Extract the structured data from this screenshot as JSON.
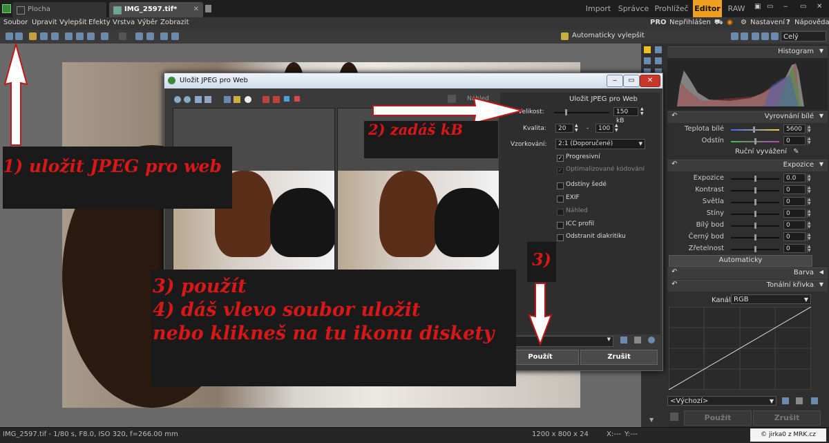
{
  "tabs": [
    {
      "label": "Plocha"
    },
    {
      "label": "IMG_2597.tif*"
    }
  ],
  "modes": {
    "import": "Import",
    "manager": "Správce",
    "viewer": "Prohlížeč",
    "editor": "Editor",
    "raw": "RAW"
  },
  "menu": [
    "Soubor",
    "Upravit",
    "Vylepšit",
    "Efekty",
    "Vrstva",
    "Výběr",
    "Zobrazit"
  ],
  "menu_right": {
    "pro": "PRO",
    "login": "Nepřihlášen",
    "settings": "Nastavení",
    "help": "Nápověda"
  },
  "toolbar_right": {
    "auto_enhance": "Automaticky vylepšit",
    "zoom": "Celý"
  },
  "panel": {
    "histogram": "Histogram",
    "white_balance": "Vyrovnání bílé",
    "wb_rows": [
      {
        "label": "Teplota bílé",
        "value": "5600"
      },
      {
        "label": "Odstín",
        "value": "0"
      }
    ],
    "manual_wb": "Ruční vyvážení",
    "exposure_title": "Expozice",
    "exposure_rows": [
      {
        "label": "Expozice",
        "value": "0.0"
      },
      {
        "label": "Kontrast",
        "value": "0"
      },
      {
        "label": "Světla",
        "value": "0"
      },
      {
        "label": "Stíny",
        "value": "0"
      },
      {
        "label": "Bílý bod",
        "value": "0"
      },
      {
        "label": "Černý bod",
        "value": "0"
      },
      {
        "label": "Zřetelnost",
        "value": "0"
      }
    ],
    "auto": "Automaticky",
    "color": "Barva",
    "tone_curve": "Tonální křivka",
    "channel_label": "Kanál:",
    "channel_value": "RGB",
    "preset": "<Výchozí>",
    "apply": "Použít",
    "cancel": "Zrušit"
  },
  "status": {
    "info": "IMG_2597.tif - 1/80 s, F8.0, ISO 320, f=266.00 mm",
    "size": "1200 x 800 x 24",
    "x": "X:---",
    "y": "Y:---",
    "credit": "© jirka0 z MRK.cz"
  },
  "dialog": {
    "title": "Uložit JPEG pro Web",
    "preview_tab": "Náhled",
    "right_title": "Uložit JPEG pro Web",
    "size_label": "Velikost:",
    "size_value": "150 kB",
    "quality_label": "Kvalita:",
    "quality_from": "20",
    "quality_dash": "-",
    "quality_to": "100",
    "sampling_label": "Vzorkování:",
    "sampling_value": "2:1 (Doporučené)",
    "options": [
      {
        "label": "Progresivní",
        "checked": true,
        "disabled": false
      },
      {
        "label": "Optimalizované kódování",
        "checked": true,
        "disabled": true
      },
      {
        "label": "Odstíny šedé",
        "checked": false,
        "disabled": false
      },
      {
        "label": "EXIF",
        "checked": false,
        "disabled": false
      },
      {
        "label": "Náhled",
        "checked": false,
        "disabled": true
      },
      {
        "label": "ICC profil",
        "checked": false,
        "disabled": false
      },
      {
        "label": "Odstranit diakritiku",
        "checked": false,
        "disabled": false
      }
    ],
    "apply": "Použít",
    "cancel": "Zrušit"
  },
  "annotations": {
    "step1": "1) uložit JPEG pro web",
    "step2": "2) zadáš kB",
    "step3": "3)",
    "step34_line1": "3) použít",
    "step34_line2": "4) dáš vlevo soubor uložit",
    "step34_line3": "nebo klikneš na tu ikonu diskety"
  },
  "colors": {
    "accent": "#f0a020",
    "annotation": "#d81818"
  }
}
